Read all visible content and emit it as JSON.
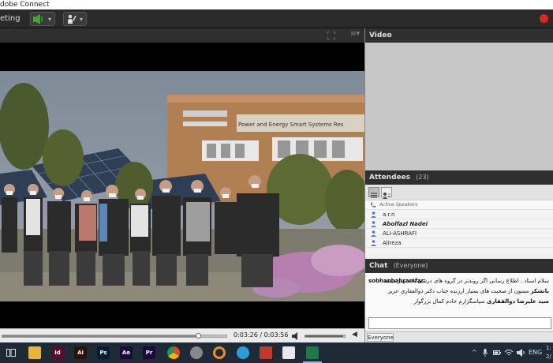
{
  "window": {
    "title": "dobe Connect"
  },
  "toolbar": {
    "meeting_label": "eting"
  },
  "share": {
    "time_current": "0:03:26",
    "time_separator": "/",
    "time_total": "0:03:56",
    "playback_progress": 0.87,
    "volume_level": 0.95,
    "banner_text": "Power and Energy Smart Systems Res"
  },
  "video_pod": {
    "title": "Video"
  },
  "attendees": {
    "title": "Attendees",
    "count": "(23)",
    "section_label": "Active Speakers",
    "items": [
      {
        "name": "a.r.n"
      },
      {
        "name": "Abolfazl Nadei"
      },
      {
        "name": "ALI-ASHRAFI"
      },
      {
        "name": "Alireza"
      }
    ]
  },
  "chat": {
    "title": "Chat",
    "scope": "(Everyone)",
    "sender": "sobhanbahramfar:",
    "messages": [
      "سلام استاد . اطلاع رسانی اگر روندتر در گروه های درسی بانه بهتر میشه",
      "ممنون از صحبت های بسیار ارزنده جناب دکتر ذوالفقاری عزیز",
      "سپاسگزارم خادم کمال بزرگوار"
    ],
    "highlight_1": "باتشکر",
    "highlight_2": "سید علیرضا ذوالفقاری",
    "footer_scope": "Everyone"
  },
  "taskbar": {
    "apps": [
      {
        "label": "Id",
        "color": "#5b0a2e"
      },
      {
        "label": "Ai",
        "color": "#2b1300"
      },
      {
        "label": "Ps",
        "color": "#001d34"
      },
      {
        "label": "Ae",
        "color": "#1a0b3d"
      },
      {
        "label": "Pr",
        "color": "#1b0b3d"
      }
    ],
    "lang": "ENG",
    "clock_1": "1:",
    "clock_2": "2/"
  },
  "colors": {
    "accent_green": "#3fa735",
    "record_red": "#e02424"
  }
}
